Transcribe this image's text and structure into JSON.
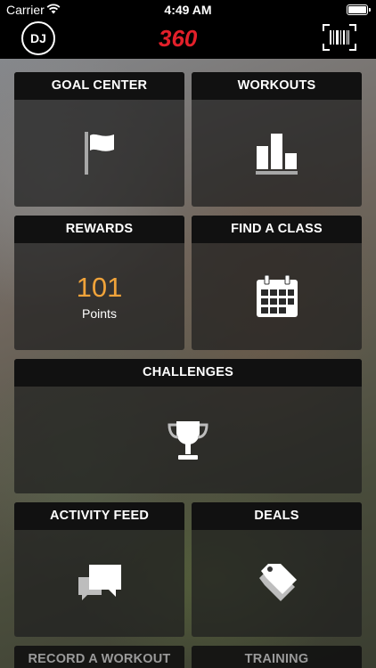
{
  "status_bar": {
    "carrier": "Carrier",
    "time": "4:49 AM",
    "wifi_icon": "wifi-icon",
    "battery_icon": "battery-icon"
  },
  "header": {
    "avatar_initials": "DJ",
    "logo_text": "360",
    "barcode_icon": "barcode-icon"
  },
  "tiles": {
    "goal_center": {
      "label": "GOAL CENTER",
      "icon": "flag-icon"
    },
    "workouts": {
      "label": "WORKOUTS",
      "icon": "bar-chart-icon"
    },
    "rewards": {
      "label": "REWARDS",
      "points": "101",
      "points_label": "Points"
    },
    "find_class": {
      "label": "FIND A CLASS",
      "icon": "calendar-icon"
    },
    "challenges": {
      "label": "CHALLENGES",
      "icon": "trophy-icon"
    },
    "activity_feed": {
      "label": "ACTIVITY FEED",
      "icon": "chat-bubbles-icon"
    },
    "deals": {
      "label": "DEALS",
      "icon": "tags-icon"
    },
    "record_workout": {
      "label": "RECORD A WORKOUT"
    },
    "training": {
      "label": "TRAINING"
    }
  },
  "colors": {
    "brand_red": "#e3202a",
    "brand_orange": "#f39c1f",
    "points_orange": "#f0a33a",
    "tile_header": "#111111"
  }
}
